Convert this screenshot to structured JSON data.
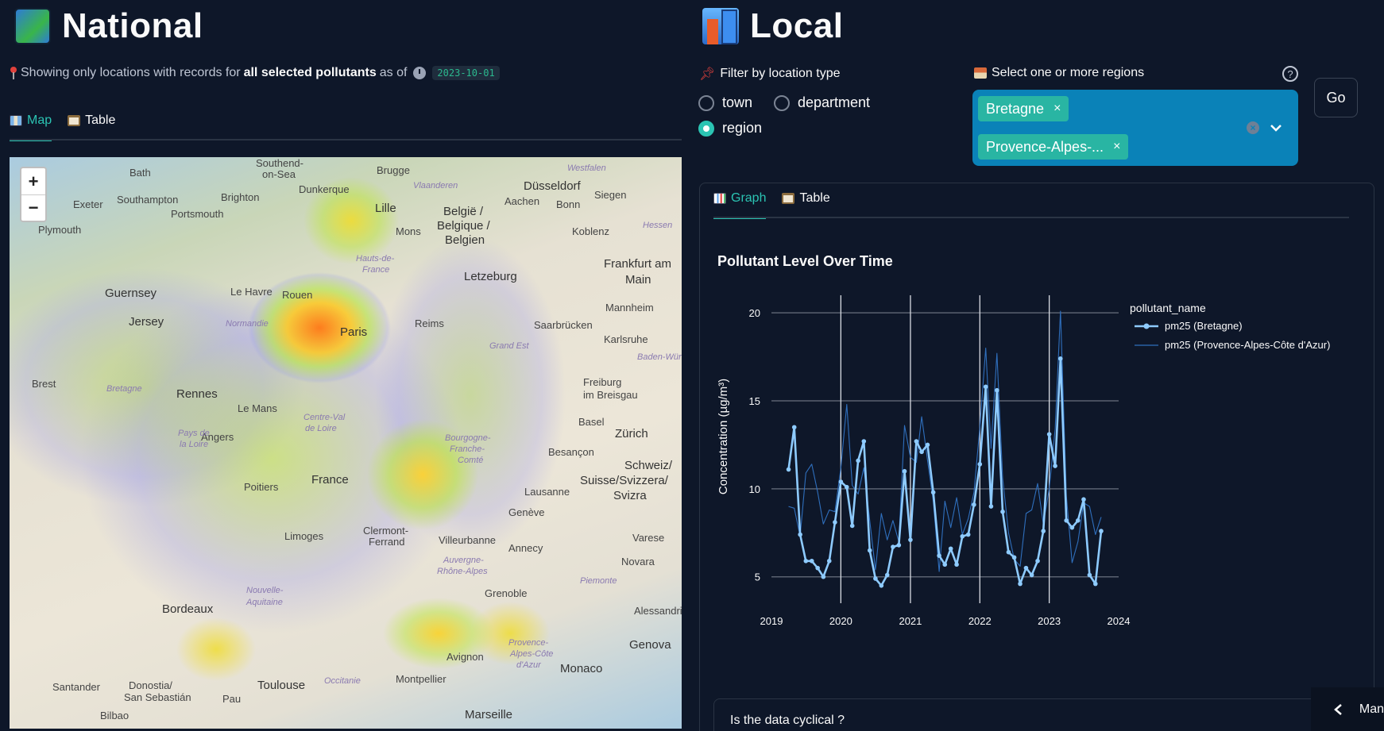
{
  "national": {
    "title": "National",
    "caption_prefix": "Showing only locations with records for",
    "caption_bold": "all selected pollutants",
    "caption_suffix": "as of",
    "date": "2023-10-01",
    "tabs": [
      {
        "label": "Map",
        "active": true
      },
      {
        "label": "Table",
        "active": false
      }
    ],
    "map": {
      "zoom_in": "+",
      "zoom_out": "−",
      "labels": [
        {
          "text": "Bath"
        },
        {
          "text": "Southend-"
        },
        {
          "text": "on-Sea"
        },
        {
          "text": "Brugge"
        },
        {
          "text": "Düsseldorf"
        },
        {
          "text": "Exeter"
        },
        {
          "text": "Southampton"
        },
        {
          "text": "Brighton"
        },
        {
          "text": "Dunkerque"
        },
        {
          "text": "Aachen"
        },
        {
          "text": "Bonn"
        },
        {
          "text": "Siegen"
        },
        {
          "text": "Portsmouth"
        },
        {
          "text": "Plymouth"
        },
        {
          "text": "Lille"
        },
        {
          "text": "België /"
        },
        {
          "text": "Belgique /"
        },
        {
          "text": "Belgien"
        },
        {
          "text": "Mons"
        },
        {
          "text": "Koblenz"
        },
        {
          "text": "Frankfurt am"
        },
        {
          "text": "Main"
        },
        {
          "text": "Guernsey"
        },
        {
          "text": "Letzeburg"
        },
        {
          "text": "Le Havre"
        },
        {
          "text": "Rouen"
        },
        {
          "text": "Mannheim"
        },
        {
          "text": "Jersey"
        },
        {
          "text": "Paris"
        },
        {
          "text": "Reims"
        },
        {
          "text": "Saarbrücken"
        },
        {
          "text": "Karlsruhe"
        },
        {
          "text": "Brest"
        },
        {
          "text": "Rennes"
        },
        {
          "text": "Le Mans"
        },
        {
          "text": "Freiburg"
        },
        {
          "text": "im Breisgau"
        },
        {
          "text": "Angers"
        },
        {
          "text": "Basel"
        },
        {
          "text": "Zürich"
        },
        {
          "text": "Besançon"
        },
        {
          "text": "Schweiz/"
        },
        {
          "text": "Suisse/Svizzera/"
        },
        {
          "text": "Svizra"
        },
        {
          "text": "Poitiers"
        },
        {
          "text": "France"
        },
        {
          "text": "Lausanne"
        },
        {
          "text": "Genève"
        },
        {
          "text": "Limoges"
        },
        {
          "text": "Clermont-"
        },
        {
          "text": "Ferrand"
        },
        {
          "text": "Villeurbanne"
        },
        {
          "text": "Annecy"
        },
        {
          "text": "Varese"
        },
        {
          "text": "Novara"
        },
        {
          "text": "Grenoble"
        },
        {
          "text": "Bordeaux"
        },
        {
          "text": "Alessandria"
        },
        {
          "text": "Genova"
        },
        {
          "text": "Avignon"
        },
        {
          "text": "Monaco"
        },
        {
          "text": "Santander"
        },
        {
          "text": "Donostia/"
        },
        {
          "text": "San Sebastián"
        },
        {
          "text": "Toulouse"
        },
        {
          "text": "Montpellier"
        },
        {
          "text": "Bilbao"
        },
        {
          "text": "Pau"
        },
        {
          "text": "Marseille"
        }
      ],
      "region_labels": [
        {
          "text": "Vlaanderen"
        },
        {
          "text": "Westfalen"
        },
        {
          "text": "Hessen"
        },
        {
          "text": "Hauts-de-"
        },
        {
          "text": "France"
        },
        {
          "text": "Normandie"
        },
        {
          "text": "Grand Est"
        },
        {
          "text": "Baden-Württem"
        },
        {
          "text": "Bretagne"
        },
        {
          "text": "Centre-Val"
        },
        {
          "text": "de Loire"
        },
        {
          "text": "Pays de"
        },
        {
          "text": "la Loire"
        },
        {
          "text": "Bourgogne-"
        },
        {
          "text": "Franche-"
        },
        {
          "text": "Comté"
        },
        {
          "text": "Nouvelle-"
        },
        {
          "text": "Aquitaine"
        },
        {
          "text": "Auvergne-"
        },
        {
          "text": "Rhône-Alpes"
        },
        {
          "text": "Piemonte"
        },
        {
          "text": "Provence-"
        },
        {
          "text": "Alpes-Côte"
        },
        {
          "text": "d'Azur"
        },
        {
          "text": "Occitanie"
        }
      ]
    }
  },
  "local": {
    "title": "Local",
    "filter_label": "Filter by location type",
    "radios": [
      {
        "label": "town",
        "selected": false
      },
      {
        "label": "department",
        "selected": false
      },
      {
        "label": "region",
        "selected": true
      }
    ],
    "region_label": "Select one or more regions",
    "help": "?",
    "chips": [
      "Bretagne",
      "Provence-Alpes-..."
    ],
    "chip_remove": "×",
    "go_label": "Go",
    "tabs": [
      {
        "label": "Graph",
        "active": true
      },
      {
        "label": "Table",
        "active": false
      }
    ],
    "expander_label": "Is the data cyclical ?"
  },
  "sidebar_toggle": {
    "label": "Man"
  },
  "chart_data": {
    "type": "line",
    "title": "Pollutant Level Over Time",
    "ylabel": "Concentration (µg/m³)",
    "xlabel": "",
    "legend_title": "pollutant_name",
    "legend_position": "right",
    "grid": true,
    "x_ticks": [
      "2019",
      "2020",
      "2021",
      "2022",
      "2023",
      "2024"
    ],
    "y_ticks": [
      5,
      10,
      15,
      20
    ],
    "xlim": [
      "2019-01-01",
      "2024-01-01"
    ],
    "ylim": [
      3.5,
      21
    ],
    "series": [
      {
        "name": "pm25 (Bretagne)",
        "color": "#8ecbff",
        "markers": true,
        "points": [
          [
            "2019-04-01",
            11.1
          ],
          [
            "2019-05-01",
            13.5
          ],
          [
            "2019-06-01",
            7.4
          ],
          [
            "2019-07-01",
            5.9
          ],
          [
            "2019-08-01",
            5.9
          ],
          [
            "2019-09-01",
            5.5
          ],
          [
            "2019-10-01",
            5.0
          ],
          [
            "2019-11-01",
            5.9
          ],
          [
            "2019-12-01",
            8.1
          ],
          [
            "2020-01-01",
            10.4
          ],
          [
            "2020-02-01",
            10.1
          ],
          [
            "2020-03-01",
            7.9
          ],
          [
            "2020-04-01",
            11.6
          ],
          [
            "2020-05-01",
            12.7
          ],
          [
            "2020-06-01",
            6.5
          ],
          [
            "2020-07-01",
            4.9
          ],
          [
            "2020-08-01",
            4.5
          ],
          [
            "2020-09-01",
            5.1
          ],
          [
            "2020-10-01",
            6.7
          ],
          [
            "2020-11-01",
            6.8
          ],
          [
            "2020-12-01",
            11.0
          ],
          [
            "2021-01-01",
            7.1
          ],
          [
            "2021-02-01",
            12.7
          ],
          [
            "2021-03-01",
            12.1
          ],
          [
            "2021-04-01",
            12.5
          ],
          [
            "2021-05-01",
            9.8
          ],
          [
            "2021-06-01",
            6.2
          ],
          [
            "2021-07-01",
            5.7
          ],
          [
            "2021-08-01",
            6.6
          ],
          [
            "2021-09-01",
            5.7
          ],
          [
            "2021-10-01",
            7.3
          ],
          [
            "2021-11-01",
            7.4
          ],
          [
            "2021-12-01",
            9.1
          ],
          [
            "2022-01-01",
            11.4
          ],
          [
            "2022-02-01",
            15.8
          ],
          [
            "2022-03-01",
            9.0
          ],
          [
            "2022-04-01",
            15.6
          ],
          [
            "2022-05-01",
            8.7
          ],
          [
            "2022-06-01",
            6.4
          ],
          [
            "2022-07-01",
            6.1
          ],
          [
            "2022-08-01",
            4.6
          ],
          [
            "2022-09-01",
            5.5
          ],
          [
            "2022-10-01",
            5.1
          ],
          [
            "2022-11-01",
            5.9
          ],
          [
            "2022-12-01",
            7.6
          ],
          [
            "2023-01-01",
            13.1
          ],
          [
            "2023-02-01",
            11.3
          ],
          [
            "2023-03-01",
            17.4
          ],
          [
            "2023-04-01",
            8.2
          ],
          [
            "2023-05-01",
            7.8
          ],
          [
            "2023-06-01",
            8.2
          ],
          [
            "2023-07-01",
            9.4
          ],
          [
            "2023-08-01",
            5.1
          ],
          [
            "2023-09-01",
            4.6
          ],
          [
            "2023-10-01",
            7.6
          ]
        ]
      },
      {
        "name": "pm25 (Provence-Alpes-Côte d'Azur)",
        "color": "#2f6fbd",
        "markers": false,
        "points": [
          [
            "2019-04-01",
            9.0
          ],
          [
            "2019-05-01",
            8.9
          ],
          [
            "2019-06-01",
            7.3
          ],
          [
            "2019-07-01",
            10.9
          ],
          [
            "2019-08-01",
            11.4
          ],
          [
            "2019-09-01",
            9.8
          ],
          [
            "2019-10-01",
            8.0
          ],
          [
            "2019-11-01",
            8.8
          ],
          [
            "2019-12-01",
            8.7
          ],
          [
            "2020-01-01",
            11.2
          ],
          [
            "2020-02-01",
            14.8
          ],
          [
            "2020-03-01",
            10.2
          ],
          [
            "2020-04-01",
            9.7
          ],
          [
            "2020-05-01",
            11.2
          ],
          [
            "2020-06-01",
            8.2
          ],
          [
            "2020-07-01",
            5.4
          ],
          [
            "2020-08-01",
            8.6
          ],
          [
            "2020-09-01",
            7.1
          ],
          [
            "2020-10-01",
            8.2
          ],
          [
            "2020-11-01",
            7.0
          ],
          [
            "2020-12-01",
            13.6
          ],
          [
            "2021-01-01",
            11.8
          ],
          [
            "2021-02-01",
            11.5
          ],
          [
            "2021-03-01",
            14.1
          ],
          [
            "2021-04-01",
            11.6
          ],
          [
            "2021-05-01",
            9.3
          ],
          [
            "2021-06-01",
            5.3
          ],
          [
            "2021-07-01",
            9.3
          ],
          [
            "2021-08-01",
            7.8
          ],
          [
            "2021-09-01",
            9.5
          ],
          [
            "2021-10-01",
            7.4
          ],
          [
            "2021-11-01",
            8.3
          ],
          [
            "2021-12-01",
            9.8
          ],
          [
            "2022-01-01",
            13.5
          ],
          [
            "2022-02-01",
            18.0
          ],
          [
            "2022-03-01",
            12.3
          ],
          [
            "2022-04-01",
            17.7
          ],
          [
            "2022-05-01",
            10.6
          ],
          [
            "2022-06-01",
            7.5
          ],
          [
            "2022-07-01",
            6.0
          ],
          [
            "2022-08-01",
            5.6
          ],
          [
            "2022-09-01",
            8.6
          ],
          [
            "2022-10-01",
            8.8
          ],
          [
            "2022-11-01",
            10.3
          ],
          [
            "2022-12-01",
            8.0
          ],
          [
            "2023-01-01",
            10.0
          ],
          [
            "2023-02-01",
            13.4
          ],
          [
            "2023-03-01",
            20.1
          ],
          [
            "2023-04-01",
            9.6
          ],
          [
            "2023-05-01",
            5.8
          ],
          [
            "2023-06-01",
            7.0
          ],
          [
            "2023-07-01",
            9.2
          ],
          [
            "2023-08-01",
            9.0
          ],
          [
            "2023-09-01",
            7.4
          ],
          [
            "2023-10-01",
            8.4
          ]
        ]
      }
    ]
  }
}
